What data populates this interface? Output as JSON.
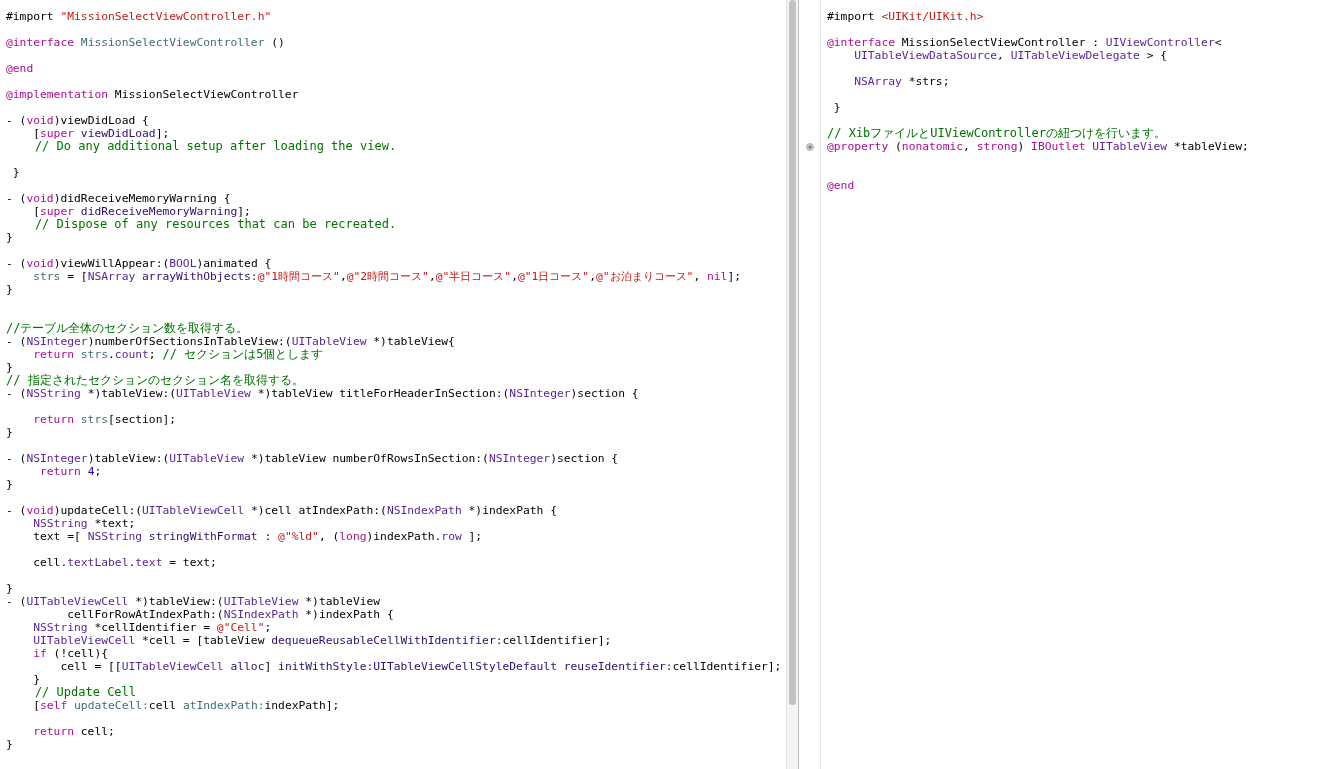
{
  "left_editor": {
    "lines": [
      {
        "kind": "code",
        "tokens": [
          {
            "text": "#import ",
            "kind": "plain"
          },
          {
            "text": "\"MissionSelectViewController.h\"",
            "kind": "string"
          }
        ]
      },
      {
        "kind": "blank"
      },
      {
        "kind": "code",
        "tokens": [
          {
            "text": "@interface ",
            "kind": "keyword"
          },
          {
            "text": "MissionSelectViewController",
            "kind": "project"
          },
          {
            "text": " ()",
            "kind": "plain"
          }
        ]
      },
      {
        "kind": "blank"
      },
      {
        "kind": "code",
        "tokens": [
          {
            "text": "@end",
            "kind": "keyword"
          }
        ]
      },
      {
        "kind": "blank"
      },
      {
        "kind": "code",
        "tokens": [
          {
            "text": "@implementation",
            "kind": "keyword"
          },
          {
            "text": " MissionSelectViewController",
            "kind": "plain"
          }
        ]
      },
      {
        "kind": "blank"
      },
      {
        "kind": "code",
        "tokens": [
          {
            "text": "- (",
            "kind": "plain"
          },
          {
            "text": "void",
            "kind": "keyword"
          },
          {
            "text": ")viewDidLoad {",
            "kind": "plain"
          }
        ]
      },
      {
        "kind": "code",
        "tokens": [
          {
            "text": "    [",
            "kind": "plain"
          },
          {
            "text": "super",
            "kind": "keyword"
          },
          {
            "text": " viewDidLoad",
            "kind": "method"
          },
          {
            "text": "];",
            "kind": "plain"
          }
        ]
      },
      {
        "kind": "code",
        "tokens": [
          {
            "text": "    // Do any additional setup after loading the view.",
            "kind": "comment"
          }
        ]
      },
      {
        "kind": "blank"
      },
      {
        "kind": "code",
        "tokens": [
          {
            "text": " }",
            "kind": "plain"
          }
        ]
      },
      {
        "kind": "blank"
      },
      {
        "kind": "code",
        "tokens": [
          {
            "text": "- (",
            "kind": "plain"
          },
          {
            "text": "void",
            "kind": "keyword"
          },
          {
            "text": ")didReceiveMemoryWarning {",
            "kind": "plain"
          }
        ]
      },
      {
        "kind": "code",
        "tokens": [
          {
            "text": "    [",
            "kind": "plain"
          },
          {
            "text": "super",
            "kind": "keyword"
          },
          {
            "text": " didReceiveMemoryWarning",
            "kind": "method"
          },
          {
            "text": "];",
            "kind": "plain"
          }
        ]
      },
      {
        "kind": "code",
        "tokens": [
          {
            "text": "    // Dispose of any resources that can be recreated.",
            "kind": "comment"
          }
        ]
      },
      {
        "kind": "code",
        "tokens": [
          {
            "text": "}",
            "kind": "plain"
          }
        ]
      },
      {
        "kind": "blank"
      },
      {
        "kind": "code",
        "tokens": [
          {
            "text": "- (",
            "kind": "plain"
          },
          {
            "text": "void",
            "kind": "keyword"
          },
          {
            "text": ")viewWillAppear:(",
            "kind": "plain"
          },
          {
            "text": "BOOL",
            "kind": "type"
          },
          {
            "text": ")animated {",
            "kind": "plain"
          }
        ]
      },
      {
        "kind": "code",
        "tokens": [
          {
            "text": "    strs",
            "kind": "project"
          },
          {
            "text": " = [",
            "kind": "plain"
          },
          {
            "text": "NSArray",
            "kind": "type"
          },
          {
            "text": " arrayWithObjects:",
            "kind": "method"
          },
          {
            "text": "@\"1時間コース\"",
            "kind": "string"
          },
          {
            "text": ",",
            "kind": "plain"
          },
          {
            "text": "@\"2時間コース\"",
            "kind": "string"
          },
          {
            "text": ",",
            "kind": "plain"
          },
          {
            "text": "@\"半日コース\"",
            "kind": "string"
          },
          {
            "text": ",",
            "kind": "plain"
          },
          {
            "text": "@\"1日コース\"",
            "kind": "string"
          },
          {
            "text": ",",
            "kind": "plain"
          },
          {
            "text": "@\"お泊まりコース\"",
            "kind": "string"
          },
          {
            "text": ", ",
            "kind": "plain"
          },
          {
            "text": "nil",
            "kind": "keyword"
          },
          {
            "text": "];",
            "kind": "plain"
          }
        ]
      },
      {
        "kind": "code",
        "tokens": [
          {
            "text": "}",
            "kind": "plain"
          }
        ]
      },
      {
        "kind": "blank"
      },
      {
        "kind": "blank"
      },
      {
        "kind": "code",
        "tokens": [
          {
            "text": "//テーブル全体のセクション数を取得する。",
            "kind": "comment"
          }
        ]
      },
      {
        "kind": "code",
        "tokens": [
          {
            "text": "- (",
            "kind": "plain"
          },
          {
            "text": "NSInteger",
            "kind": "type"
          },
          {
            "text": ")numberOfSectionsInTableView:(",
            "kind": "plain"
          },
          {
            "text": "UITableView",
            "kind": "type"
          },
          {
            "text": " *)tableView{",
            "kind": "plain"
          }
        ]
      },
      {
        "kind": "code",
        "tokens": [
          {
            "text": "    return",
            "kind": "keyword"
          },
          {
            "text": " strs",
            "kind": "project"
          },
          {
            "text": ".",
            "kind": "plain"
          },
          {
            "text": "count",
            "kind": "type"
          },
          {
            "text": "; ",
            "kind": "plain"
          },
          {
            "text": "// セクションは5個とします",
            "kind": "comment"
          }
        ]
      },
      {
        "kind": "code",
        "tokens": [
          {
            "text": "}",
            "kind": "plain"
          }
        ]
      },
      {
        "kind": "code",
        "tokens": [
          {
            "text": "// 指定されたセクションのセクション名を取得する。",
            "kind": "comment"
          }
        ]
      },
      {
        "kind": "code",
        "tokens": [
          {
            "text": "- (",
            "kind": "plain"
          },
          {
            "text": "NSString",
            "kind": "type"
          },
          {
            "text": " *)tableView:(",
            "kind": "plain"
          },
          {
            "text": "UITableView",
            "kind": "type"
          },
          {
            "text": " *)tableView titleForHeaderInSection:(",
            "kind": "plain"
          },
          {
            "text": "NSInteger",
            "kind": "type"
          },
          {
            "text": ")section {",
            "kind": "plain"
          }
        ]
      },
      {
        "kind": "blank"
      },
      {
        "kind": "code",
        "tokens": [
          {
            "text": "    return",
            "kind": "keyword"
          },
          {
            "text": " strs",
            "kind": "project"
          },
          {
            "text": "[section];",
            "kind": "plain"
          }
        ]
      },
      {
        "kind": "code",
        "tokens": [
          {
            "text": "}",
            "kind": "plain"
          }
        ]
      },
      {
        "kind": "blank"
      },
      {
        "kind": "code",
        "tokens": [
          {
            "text": "- (",
            "kind": "plain"
          },
          {
            "text": "NSInteger",
            "kind": "type"
          },
          {
            "text": ")tableView:(",
            "kind": "plain"
          },
          {
            "text": "UITableView",
            "kind": "type"
          },
          {
            "text": " *)tableView numberOfRowsInSection:(",
            "kind": "plain"
          },
          {
            "text": "NSInteger",
            "kind": "type"
          },
          {
            "text": ")section {",
            "kind": "plain"
          }
        ]
      },
      {
        "kind": "code",
        "tokens": [
          {
            "text": "     return",
            "kind": "keyword"
          },
          {
            "text": " 4",
            "kind": "number"
          },
          {
            "text": ";",
            "kind": "plain"
          }
        ]
      },
      {
        "kind": "code",
        "tokens": [
          {
            "text": "}",
            "kind": "plain"
          }
        ]
      },
      {
        "kind": "blank"
      },
      {
        "kind": "code",
        "tokens": [
          {
            "text": "- (",
            "kind": "plain"
          },
          {
            "text": "void",
            "kind": "keyword"
          },
          {
            "text": ")updateCell:(",
            "kind": "plain"
          },
          {
            "text": "UITableViewCell",
            "kind": "type"
          },
          {
            "text": " *)cell atIndexPath:(",
            "kind": "plain"
          },
          {
            "text": "NSIndexPath",
            "kind": "type"
          },
          {
            "text": " *)indexPath {",
            "kind": "plain"
          }
        ]
      },
      {
        "kind": "code",
        "tokens": [
          {
            "text": "    NSString",
            "kind": "type"
          },
          {
            "text": " *text;",
            "kind": "plain"
          }
        ]
      },
      {
        "kind": "code",
        "tokens": [
          {
            "text": "    text =[ ",
            "kind": "plain"
          },
          {
            "text": "NSString",
            "kind": "type"
          },
          {
            "text": " stringWithFormat",
            "kind": "method"
          },
          {
            "text": " : ",
            "kind": "plain"
          },
          {
            "text": "@\"%ld\"",
            "kind": "string"
          },
          {
            "text": ", (",
            "kind": "plain"
          },
          {
            "text": "long",
            "kind": "keyword"
          },
          {
            "text": ")indexPath.",
            "kind": "plain"
          },
          {
            "text": "row",
            "kind": "type"
          },
          {
            "text": " ];",
            "kind": "plain"
          }
        ]
      },
      {
        "kind": "blank"
      },
      {
        "kind": "code",
        "tokens": [
          {
            "text": "    cell.",
            "kind": "plain"
          },
          {
            "text": "textLabel",
            "kind": "type"
          },
          {
            "text": ".",
            "kind": "plain"
          },
          {
            "text": "text",
            "kind": "type"
          },
          {
            "text": " = text;",
            "kind": "plain"
          }
        ]
      },
      {
        "kind": "blank"
      },
      {
        "kind": "code",
        "tokens": [
          {
            "text": "}",
            "kind": "plain"
          }
        ]
      },
      {
        "kind": "code",
        "tokens": [
          {
            "text": "- (",
            "kind": "plain"
          },
          {
            "text": "UITableViewCell",
            "kind": "type"
          },
          {
            "text": " *)tableView:(",
            "kind": "plain"
          },
          {
            "text": "UITableView",
            "kind": "type"
          },
          {
            "text": " *)tableView",
            "kind": "plain"
          }
        ]
      },
      {
        "kind": "code",
        "tokens": [
          {
            "text": "         cellForRowAtIndexPath:(",
            "kind": "plain"
          },
          {
            "text": "NSIndexPath",
            "kind": "type"
          },
          {
            "text": " *)indexPath {",
            "kind": "plain"
          }
        ]
      },
      {
        "kind": "code",
        "tokens": [
          {
            "text": "    NSString",
            "kind": "type"
          },
          {
            "text": " *cellIdentifier = ",
            "kind": "plain"
          },
          {
            "text": "@\"Cell\"",
            "kind": "string"
          },
          {
            "text": ";",
            "kind": "plain"
          }
        ]
      },
      {
        "kind": "code",
        "tokens": [
          {
            "text": "    UITableViewCell",
            "kind": "type"
          },
          {
            "text": " *cell = [tableView ",
            "kind": "plain"
          },
          {
            "text": "dequeueReusableCellWithIdentifier:",
            "kind": "method"
          },
          {
            "text": "cellIdentifier];",
            "kind": "plain"
          }
        ]
      },
      {
        "kind": "code",
        "tokens": [
          {
            "text": "    if",
            "kind": "keyword"
          },
          {
            "text": " (!cell){",
            "kind": "plain"
          }
        ]
      },
      {
        "kind": "code",
        "tokens": [
          {
            "text": "        cell = [[",
            "kind": "plain"
          },
          {
            "text": "UITableViewCell",
            "kind": "type"
          },
          {
            "text": " alloc",
            "kind": "method"
          },
          {
            "text": "] ",
            "kind": "plain"
          },
          {
            "text": "initWithStyle:UITableViewCellStyleDefault reuseIdentifier:",
            "kind": "method"
          },
          {
            "text": "cellIdentifier];",
            "kind": "plain"
          }
        ]
      },
      {
        "kind": "code",
        "tokens": [
          {
            "text": "    }",
            "kind": "plain"
          }
        ]
      },
      {
        "kind": "code",
        "tokens": [
          {
            "text": "    // Update Cell",
            "kind": "comment"
          }
        ]
      },
      {
        "kind": "code",
        "tokens": [
          {
            "text": "    [",
            "kind": "plain"
          },
          {
            "text": "self",
            "kind": "keyword"
          },
          {
            "text": " updateCell:",
            "kind": "project"
          },
          {
            "text": "cell ",
            "kind": "plain"
          },
          {
            "text": "atIndexPath:",
            "kind": "project"
          },
          {
            "text": "indexPath];",
            "kind": "plain"
          }
        ]
      },
      {
        "kind": "blank"
      },
      {
        "kind": "code",
        "tokens": [
          {
            "text": "    return",
            "kind": "keyword"
          },
          {
            "text": " cell;",
            "kind": "plain"
          }
        ]
      },
      {
        "kind": "code",
        "tokens": [
          {
            "text": "}",
            "kind": "plain"
          }
        ]
      }
    ]
  },
  "right_editor": {
    "lines": [
      {
        "kind": "code",
        "outlet": false,
        "tokens": [
          {
            "text": "#import ",
            "kind": "plain"
          },
          {
            "text": "<UIKit/UIKit.h>",
            "kind": "string"
          }
        ]
      },
      {
        "kind": "blank",
        "outlet": false
      },
      {
        "kind": "code",
        "outlet": false,
        "tokens": [
          {
            "text": "@interface",
            "kind": "keyword"
          },
          {
            "text": " MissionSelectViewController : ",
            "kind": "plain"
          },
          {
            "text": "UIViewController",
            "kind": "type"
          },
          {
            "text": "<",
            "kind": "plain"
          }
        ]
      },
      {
        "kind": "code",
        "outlet": false,
        "tokens": [
          {
            "text": "    UITableViewDataSource",
            "kind": "type"
          },
          {
            "text": ", ",
            "kind": "plain"
          },
          {
            "text": "UITableViewDelegate",
            "kind": "type"
          },
          {
            "text": " > {",
            "kind": "plain"
          }
        ]
      },
      {
        "kind": "blank",
        "outlet": false
      },
      {
        "kind": "code",
        "outlet": false,
        "tokens": [
          {
            "text": "    NSArray",
            "kind": "type"
          },
          {
            "text": " *strs;",
            "kind": "plain"
          }
        ]
      },
      {
        "kind": "blank",
        "outlet": false
      },
      {
        "kind": "code",
        "outlet": false,
        "tokens": [
          {
            "text": " }",
            "kind": "plain"
          }
        ]
      },
      {
        "kind": "blank",
        "outlet": false
      },
      {
        "kind": "code",
        "outlet": false,
        "tokens": [
          {
            "text": "// XibファイルとUIViewControllerの紐つけを行います。",
            "kind": "comment"
          }
        ]
      },
      {
        "kind": "code",
        "outlet": true,
        "tokens": [
          {
            "text": "@property",
            "kind": "keyword"
          },
          {
            "text": " (",
            "kind": "plain"
          },
          {
            "text": "nonatomic",
            "kind": "keyword"
          },
          {
            "text": ", ",
            "kind": "plain"
          },
          {
            "text": "strong",
            "kind": "keyword"
          },
          {
            "text": ") ",
            "kind": "plain"
          },
          {
            "text": "IBOutlet",
            "kind": "keyword"
          },
          {
            "text": " UITableView",
            "kind": "type"
          },
          {
            "text": " *tableView;",
            "kind": "plain"
          }
        ]
      },
      {
        "kind": "blank",
        "outlet": false
      },
      {
        "kind": "blank",
        "outlet": false
      },
      {
        "kind": "code",
        "outlet": false,
        "tokens": [
          {
            "text": "@end",
            "kind": "keyword"
          }
        ]
      }
    ]
  }
}
